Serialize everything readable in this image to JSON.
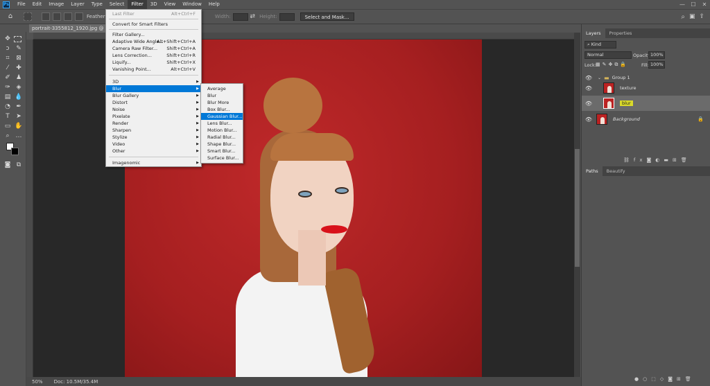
{
  "app": {
    "logo": "Ps"
  },
  "menubar": [
    "File",
    "Edit",
    "Image",
    "Layer",
    "Type",
    "Select",
    "Filter",
    "3D",
    "View",
    "Window",
    "Help"
  ],
  "window_controls": [
    "—",
    "☐",
    "✕"
  ],
  "options": {
    "feather": "Feather:",
    "width": "Width:",
    "height": "Height:",
    "select_mask": "Select and Mask..."
  },
  "document": {
    "tab": "portrait-3355812_1920.jpg @ 50% (blur, RGB/8) *",
    "zoom": "50%",
    "doc_size": "Doc: 10.5M/35.4M"
  },
  "filter_menu": {
    "items": [
      {
        "label": "Last Filter",
        "shortcut": "Alt+Ctrl+F",
        "disabled": true
      },
      {
        "label": "Convert for Smart Filters",
        "shortcut": ""
      },
      {
        "label": "Filter Gallery...",
        "shortcut": ""
      },
      {
        "label": "Adaptive Wide Angle...",
        "shortcut": "Alt+Shift+Ctrl+A"
      },
      {
        "label": "Camera Raw Filter...",
        "shortcut": "Shift+Ctrl+A"
      },
      {
        "label": "Lens Correction...",
        "shortcut": "Shift+Ctrl+R"
      },
      {
        "label": "Liquify...",
        "shortcut": "Shift+Ctrl+X"
      },
      {
        "label": "Vanishing Point...",
        "shortcut": "Alt+Ctrl+V"
      },
      {
        "label": "3D",
        "submenu": true
      },
      {
        "label": "Blur",
        "submenu": true,
        "highlighted": true
      },
      {
        "label": "Blur Gallery",
        "submenu": true
      },
      {
        "label": "Distort",
        "submenu": true
      },
      {
        "label": "Noise",
        "submenu": true
      },
      {
        "label": "Pixelate",
        "submenu": true
      },
      {
        "label": "Render",
        "submenu": true
      },
      {
        "label": "Sharpen",
        "submenu": true
      },
      {
        "label": "Stylize",
        "submenu": true
      },
      {
        "label": "Video",
        "submenu": true
      },
      {
        "label": "Other",
        "submenu": true
      },
      {
        "label": "Imagenomic",
        "submenu": true
      }
    ]
  },
  "blur_submenu": {
    "items": [
      "Average",
      "Blur",
      "Blur More",
      "Box Blur...",
      "Gaussian Blur...",
      "Lens Blur...",
      "Motion Blur...",
      "Radial Blur...",
      "Shape Blur...",
      "Smart Blur...",
      "Surface Blur..."
    ],
    "highlighted": "Gaussian Blur..."
  },
  "layers_panel": {
    "tabs": [
      "Layers",
      "Properties"
    ],
    "filter_kind": "Kind",
    "blend_mode": "Normal",
    "opacity_label": "Opacity:",
    "opacity": "100%",
    "lock_label": "Lock:",
    "fill_label": "Fill:",
    "fill": "100%",
    "layers": [
      {
        "name": "Group 1",
        "type": "group"
      },
      {
        "name": "texture",
        "type": "layer"
      },
      {
        "name": "blur",
        "type": "layer",
        "selected": true
      },
      {
        "name": "Background",
        "type": "background",
        "locked": true
      }
    ]
  },
  "paths_panel": {
    "tabs": [
      "Paths",
      "Beautify"
    ]
  },
  "colors": {
    "accent": "#0078d7",
    "canvas_red": "#a51f20",
    "highlight_yellow": "#d9d92a"
  }
}
